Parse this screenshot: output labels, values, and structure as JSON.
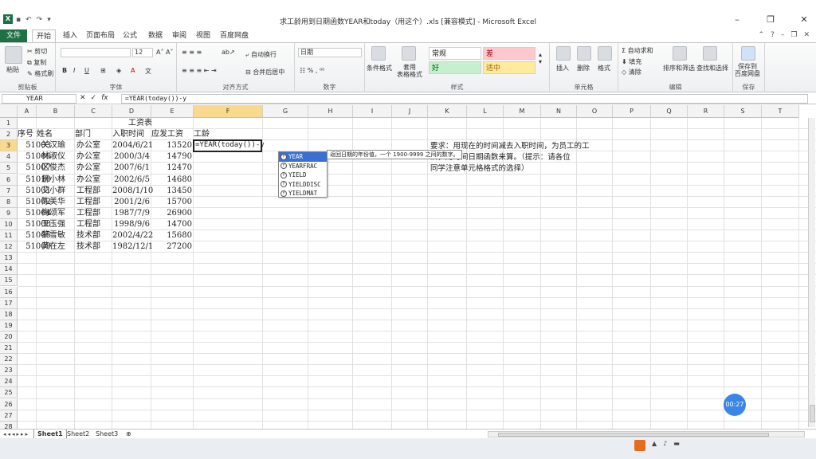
{
  "window": {
    "title": "求工龄用到日期函数YEAR和today（用这个）.xls [兼容模式] - Microsoft Excel",
    "app_icon": "X"
  },
  "tabs": [
    "文件",
    "开始",
    "插入",
    "页面布局",
    "公式",
    "数据",
    "审阅",
    "视图",
    "百度网盘"
  ],
  "active_tab": "开始",
  "ribbon": {
    "clipboard": {
      "paste": "粘贴",
      "cut": "剪切",
      "copy": "复制",
      "format_painter": "格式刷",
      "label": "剪贴板"
    },
    "font": {
      "size": "12",
      "label": "字体"
    },
    "alignment": {
      "wrap": "自动换行",
      "merge": "合并后居中",
      "label": "对齐方式"
    },
    "number": {
      "format": "日期",
      "label": "数字"
    },
    "styles": {
      "conditional": "条件格式",
      "table": "套用\n表格格式",
      "normal": "常规",
      "bad": "差",
      "good": "好",
      "neutral": "适中",
      "label": "样式"
    },
    "cells": {
      "insert": "插入",
      "delete": "删除",
      "format": "格式",
      "label": "单元格"
    },
    "editing": {
      "autosum": "自动求和",
      "fill": "填充",
      "clear": "清除",
      "sort": "排序和筛选",
      "find": "查找和选择",
      "label": "编辑"
    },
    "save": {
      "btn": "保存到\n百度网盘",
      "label": "保存"
    }
  },
  "formula_bar": {
    "name_box": "YEAR",
    "formula": "=YEAR(today())-y"
  },
  "columns": [
    "A",
    "B",
    "C",
    "D",
    "E",
    "F",
    "G",
    "H",
    "I",
    "J",
    "K",
    "L",
    "M",
    "N",
    "O",
    "P",
    "Q",
    "R",
    "S",
    "T"
  ],
  "rows": [
    "1",
    "2",
    "3",
    "4",
    "5",
    "6",
    "7",
    "8",
    "9",
    "10",
    "11",
    "12",
    "13",
    "14",
    "15",
    "16",
    "17",
    "18",
    "19",
    "20",
    "21",
    "22",
    "23",
    "24",
    "25",
    "26",
    "27",
    "28"
  ],
  "sheet": {
    "title": "工资表",
    "headers": [
      "序号",
      "姓名",
      "部门",
      "入职时间",
      "应发工资",
      "工龄"
    ],
    "data": [
      [
        "51003",
        "关汉瑜",
        "办公室",
        "2004/6/21",
        "13520"
      ],
      [
        "51006",
        "林淑仪",
        "办公室",
        "2000/3/4",
        "14790"
      ],
      [
        "51007",
        "区俊杰",
        "办公室",
        "2007/6/1",
        "12470"
      ],
      [
        "51010",
        "册小林",
        "办公室",
        "2002/6/5",
        "14680"
      ],
      [
        "51001",
        "艾小群",
        "工程部",
        "2008/1/10",
        "13450"
      ],
      [
        "51002",
        "陈美华",
        "工程部",
        "2001/2/6",
        "15700"
      ],
      [
        "51004",
        "梅颂军",
        "工程部",
        "1987/7/9",
        "26900"
      ],
      [
        "51008",
        "王玉强",
        "工程部",
        "1998/9/6",
        "14700"
      ],
      [
        "51005",
        "蔡雪敏",
        "技术部",
        "2002/4/22",
        "15680"
      ],
      [
        "51009",
        "黄在左",
        "技术部",
        "1982/12/1",
        "27200"
      ]
    ],
    "active_cell_text": "=YEAR(today())-y",
    "note": [
      "要求：用现在的时间减去入职时间，为员工的工",
      "龄，用时间日期函数来算。（提示：请各位",
      "同学注意单元格格式的选择）"
    ]
  },
  "autocomplete": {
    "items": [
      "YEAR",
      "YEARFRAC",
      "YIELD",
      "YIELDDISC",
      "YIELDMAT"
    ],
    "tooltip": "返回日期的年份值，一个 1900-9999 之间的数字。"
  },
  "sheet_tabs": [
    "Sheet1",
    "Sheet2",
    "Sheet3"
  ],
  "active_sheet": "Sheet1",
  "timer": "00:27"
}
